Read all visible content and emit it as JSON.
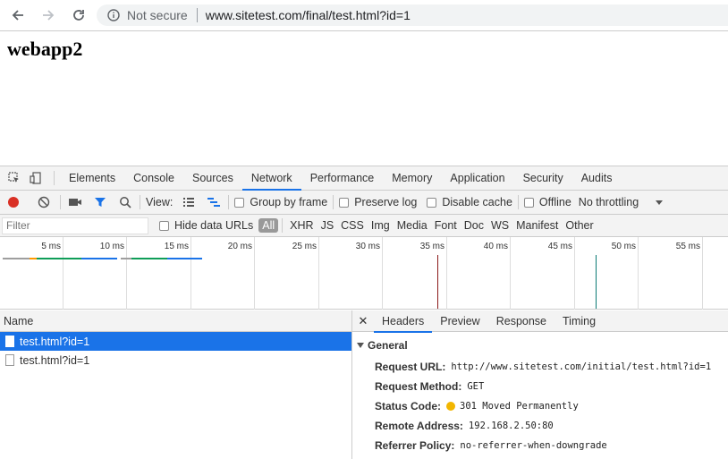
{
  "browser": {
    "security_label": "Not secure",
    "url": "www.sitetest.com/final/test.html?id=1"
  },
  "page": {
    "heading": "webapp2"
  },
  "devtools": {
    "tabs": [
      {
        "label": "Elements"
      },
      {
        "label": "Console"
      },
      {
        "label": "Sources"
      },
      {
        "label": "Network",
        "active": true
      },
      {
        "label": "Performance"
      },
      {
        "label": "Memory"
      },
      {
        "label": "Application"
      },
      {
        "label": "Security"
      },
      {
        "label": "Audits"
      }
    ],
    "toolbar": {
      "view_label": "View:",
      "group_by_frame": "Group by frame",
      "preserve_log": "Preserve log",
      "disable_cache": "Disable cache",
      "offline": "Offline",
      "throttling": "No throttling"
    },
    "filter": {
      "placeholder": "Filter",
      "hide_data_urls": "Hide data URLs",
      "types": [
        "All",
        "XHR",
        "JS",
        "CSS",
        "Img",
        "Media",
        "Font",
        "Doc",
        "WS",
        "Manifest",
        "Other"
      ]
    },
    "overview": {
      "tick_labels": [
        "5 ms",
        "10 ms",
        "15 ms",
        "20 ms",
        "25 ms",
        "30 ms",
        "35 ms",
        "40 ms",
        "45 ms",
        "50 ms",
        "55 ms"
      ]
    },
    "requests": {
      "column_name": "Name",
      "rows": [
        {
          "name": "test.html?id=1",
          "selected": true
        },
        {
          "name": "test.html?id=1",
          "selected": false
        }
      ]
    },
    "detail": {
      "tabs": [
        "Headers",
        "Preview",
        "Response",
        "Timing"
      ],
      "section_title": "General",
      "headers": [
        {
          "key": "Request URL:",
          "value": "http://www.sitetest.com/initial/test.html?id=1"
        },
        {
          "key": "Request Method:",
          "value": "GET"
        },
        {
          "key": "Status Code:",
          "value": "301 Moved Permanently"
        },
        {
          "key": "Remote Address:",
          "value": "192.168.2.50:80"
        },
        {
          "key": "Referrer Policy:",
          "value": "no-referrer-when-downgrade"
        }
      ]
    },
    "colors": {
      "accent": "#1a73e8",
      "record": "#d93025",
      "status_warning": "#f2b600"
    }
  }
}
